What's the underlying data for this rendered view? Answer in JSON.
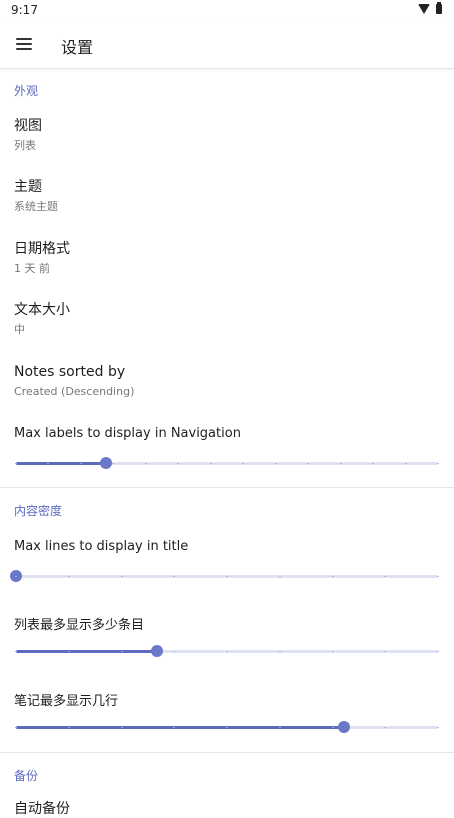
{
  "status_bar": {
    "time": "9:17"
  },
  "app_bar": {
    "title": "设置"
  },
  "sections": {
    "appearance": "外观",
    "density": "内容密度",
    "backup": "备份"
  },
  "items": {
    "view": {
      "title": "视图",
      "value": "列表"
    },
    "theme": {
      "title": "主题",
      "value": "系统主题"
    },
    "date_format": {
      "title": "日期格式",
      "value": "1 天 前"
    },
    "text_size": {
      "title": "文本大小",
      "value": "中"
    },
    "notes_sorted": {
      "title": "Notes sorted by",
      "value": "Created (Descending)"
    }
  },
  "sliders": {
    "nav_labels": {
      "label": "Max labels to display in Navigation",
      "fraction": 0.213
    },
    "title_lines": {
      "label": "Max lines to display in title",
      "fraction": 0.0
    },
    "list_items": {
      "label": "列表最多显示多少条目",
      "fraction": 0.333
    },
    "note_lines": {
      "label": "笔记最多显示几行",
      "fraction": 0.778
    }
  },
  "partial_item": {
    "title": "自动备份"
  },
  "colors": {
    "accent": "#5c6bc0",
    "track": "#dfe2f3"
  }
}
